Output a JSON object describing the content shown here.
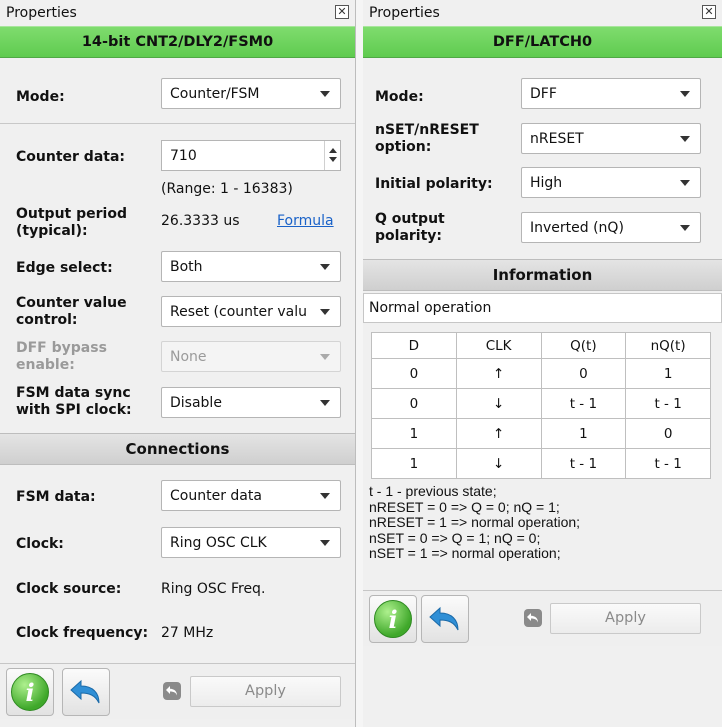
{
  "left": {
    "title": "Properties",
    "header": "14-bit CNT2/DLY2/FSM0",
    "mode": {
      "label": "Mode:",
      "value": "Counter/FSM"
    },
    "counter_data": {
      "label": "Counter data:",
      "value": "710",
      "range": "(Range:  1 - 16383)"
    },
    "output_period": {
      "label1": "Output period",
      "label2": "(typical):",
      "value": "26.3333 us",
      "link": "Formula"
    },
    "edge_select": {
      "label": "Edge select:",
      "value": "Both"
    },
    "counter_value_control": {
      "label1": "Counter value",
      "label2": "control:",
      "value": "Reset (counter valu"
    },
    "dff_bypass": {
      "label1": "DFF bypass",
      "label2": "enable:",
      "value": "None"
    },
    "fsm_sync": {
      "label1": "FSM data sync",
      "label2": "with SPI clock:",
      "value": "Disable"
    },
    "connections_header": "Connections",
    "fsm_data": {
      "label": "FSM data:",
      "value": "Counter data"
    },
    "clock": {
      "label": "Clock:",
      "value": "Ring OSC CLK"
    },
    "clock_source": {
      "label": "Clock source:",
      "value": "Ring OSC Freq."
    },
    "clock_frequency": {
      "label": "Clock frequency:",
      "value": "27 MHz"
    },
    "apply": "Apply"
  },
  "right": {
    "title": "Properties",
    "header": "DFF/LATCH0",
    "mode": {
      "label": "Mode:",
      "value": "DFF"
    },
    "nset_option": {
      "label1": "nSET/nRESET",
      "label2": "option:",
      "value": "nRESET"
    },
    "initial_polarity": {
      "label": "Initial polarity:",
      "value": "High"
    },
    "q_output": {
      "label1": "Q output",
      "label2": "polarity:",
      "value": "Inverted (nQ)"
    },
    "information_header": "Information",
    "operation": "Normal operation",
    "table": {
      "headers": [
        "D",
        "CLK",
        "Q(t)",
        "nQ(t)"
      ],
      "rows": [
        [
          "0",
          "↑",
          "0",
          "1"
        ],
        [
          "0",
          "↓",
          "t - 1",
          "t - 1"
        ],
        [
          "1",
          "↑",
          "1",
          "0"
        ],
        [
          "1",
          "↓",
          "t - 1",
          "t - 1"
        ]
      ]
    },
    "notes": [
      "t - 1 - previous state;",
      "nRESET = 0 => Q = 0; nQ = 1;",
      "nRESET = 1 => normal operation;",
      "nSET = 0 => Q = 1; nQ = 0;",
      "nSET = 1 => normal operation;"
    ],
    "apply": "Apply"
  },
  "icons": {
    "close": "close-icon",
    "info": "info-icon",
    "undo": "undo-icon"
  },
  "colors": {
    "header_green": "#66cf55",
    "link": "#1a62c8",
    "info_green": "#3fa82a",
    "undo_blue": "#2f8fd6"
  }
}
